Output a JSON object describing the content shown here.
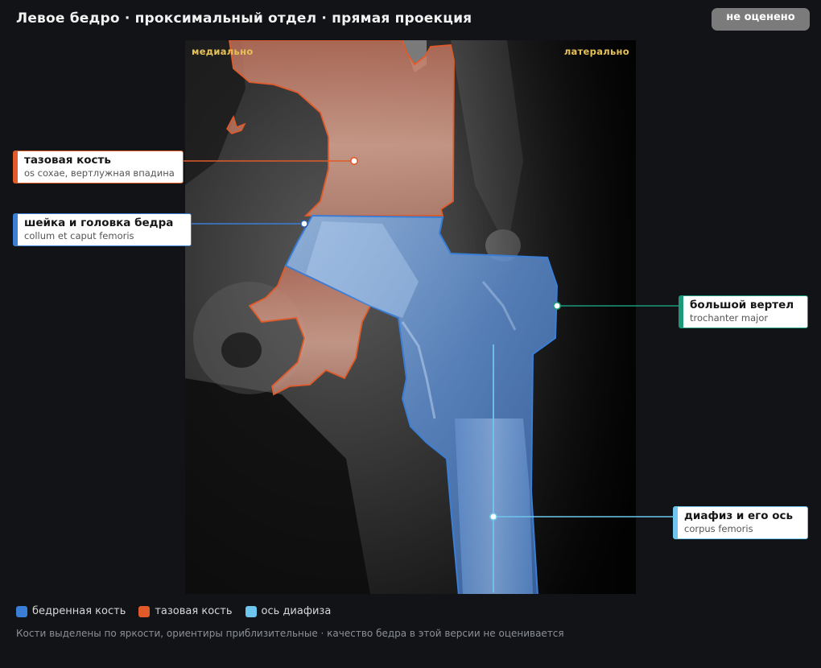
{
  "header": {
    "title": "Левое бедро · проксимальный отдел · прямая проекция",
    "status_badge": "не оценено"
  },
  "viewer": {
    "orientation_left": "медиально",
    "orientation_right": "латерально"
  },
  "annotations": [
    {
      "id": "pelvis",
      "title": "тазовая кость",
      "subtitle": "os coxae, вертлужная впадина",
      "color": "#e05a2a"
    },
    {
      "id": "neck",
      "title": "шейка и головка бедра",
      "subtitle": "collum et caput femoris",
      "color": "#3a7ed6"
    },
    {
      "id": "trochanter",
      "title": "большой вертел",
      "subtitle": "trochanter major",
      "color": "#1a9a78"
    },
    {
      "id": "shaft",
      "title": "диафиз и его ось",
      "subtitle": "corpus femoris",
      "color": "#6ec6ee"
    }
  ],
  "legend": [
    {
      "label": "бедренная кость",
      "color": "#3a7ed6"
    },
    {
      "label": "тазовая кость",
      "color": "#e05a2a"
    },
    {
      "label": "ось диафиза",
      "color": "#6ec6ee"
    }
  ],
  "footnote": "Кости выделены по яркости, ориентиры приблизительные · качество бедра в этой версии не оценивается",
  "colors": {
    "background": "#121317",
    "femur_fill": "#5a8fd8",
    "pelvis_fill": "#d9856a",
    "axis_line": "#6ec6ee",
    "orientation_text": "#e6c256"
  }
}
